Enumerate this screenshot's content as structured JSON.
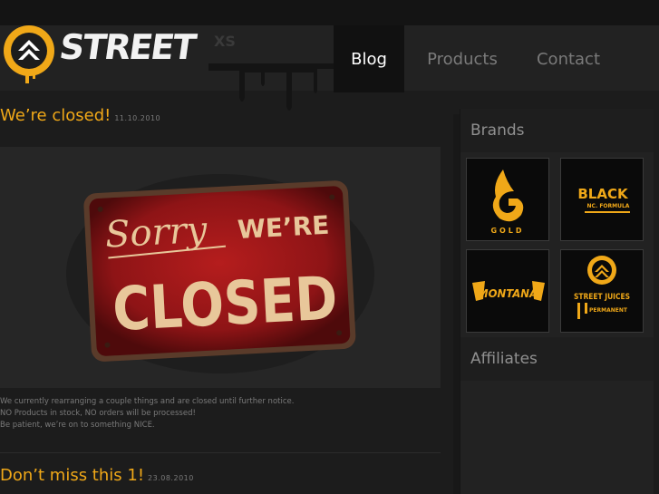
{
  "header": {
    "logo_text": "STREET",
    "logo_ghost_text": "XS"
  },
  "nav": {
    "items": [
      "Blog",
      "Products",
      "Contact"
    ],
    "active": "Blog"
  },
  "posts": [
    {
      "title": "We’re closed!",
      "date": "11.10.2010",
      "image": {
        "line1": "Sorry",
        "line2": "WE’RE",
        "line3": "CLOSED"
      },
      "body": [
        "We currently rearranging a couple things and are closed until further notice.",
        "NO Products in stock, NO orders will be processed!",
        "Be patient, we’re on to something NICE."
      ]
    },
    {
      "title": "Don’t miss this 1!",
      "date": "23.08.2010"
    }
  ],
  "sidebar": {
    "brands_heading": "Brands",
    "affiliates_heading": "Affiliates",
    "brands": [
      {
        "name": "gold",
        "text": "GOLD"
      },
      {
        "name": "black",
        "text": "BLACK",
        "sub": "NC. FORMULA"
      },
      {
        "name": "montana",
        "text": "MONTANA"
      },
      {
        "name": "street-juices",
        "text": "STREET JUICES",
        "sub": "PERMANENT"
      }
    ]
  },
  "colors": {
    "accent": "#f0a818",
    "sign_red": "#8e1416",
    "sign_text": "#e8c79a"
  }
}
